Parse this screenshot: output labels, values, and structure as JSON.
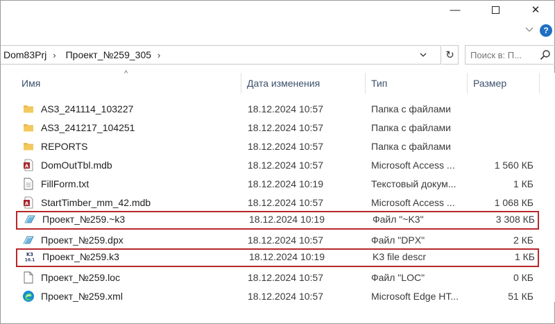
{
  "window": {
    "controls": {
      "minimize": "—",
      "close": "✕"
    }
  },
  "address": {
    "crumbs": [
      "Dom83Prj",
      "Проект_№259_305"
    ],
    "separator": "›",
    "dropdown": "⌄",
    "refresh": "↻"
  },
  "search": {
    "placeholder": "Поиск в: П..."
  },
  "help": {
    "label": "?"
  },
  "columns": {
    "name": "Имя",
    "date": "Дата изменения",
    "type": "Тип",
    "size": "Размер",
    "sort_indicator": "^"
  },
  "files": [
    {
      "icon": "folder-icon",
      "name": "AS3_241114_103227",
      "date": "18.12.2024 10:57",
      "type": "Папка с файлами",
      "size": "",
      "highlighted": false
    },
    {
      "icon": "folder-icon",
      "name": "AS3_241217_104251",
      "date": "18.12.2024 10:57",
      "type": "Папка с файлами",
      "size": "",
      "highlighted": false
    },
    {
      "icon": "folder-icon",
      "name": "REPORTS",
      "date": "18.12.2024 10:57",
      "type": "Папка с файлами",
      "size": "",
      "highlighted": false
    },
    {
      "icon": "access-db-icon",
      "name": "DomOutTbl.mdb",
      "date": "18.12.2024 10:57",
      "type": "Microsoft Access ...",
      "size": "1 560 КБ",
      "highlighted": false
    },
    {
      "icon": "text-file-icon",
      "name": "FillForm.txt",
      "date": "18.12.2024 10:19",
      "type": "Текстовый докум...",
      "size": "1 КБ",
      "highlighted": false
    },
    {
      "icon": "access-db-icon",
      "name": "StartTimber_mm_42.mdb",
      "date": "18.12.2024 10:57",
      "type": "Microsoft Access ...",
      "size": "1 068 КБ",
      "highlighted": false
    },
    {
      "icon": "k3-project-icon",
      "name": "Проект_№259.~k3",
      "date": "18.12.2024 10:19",
      "type": "Файл \"~K3\"",
      "size": "3 308 КБ",
      "highlighted": true
    },
    {
      "icon": "k3-project-icon",
      "name": "Проект_№259.dpx",
      "date": "18.12.2024 10:57",
      "type": "Файл \"DPX\"",
      "size": "2 КБ",
      "highlighted": false
    },
    {
      "icon": "k3-app-icon",
      "name": "Проект_№259.k3",
      "date": "18.12.2024 10:19",
      "type": "K3 file descr",
      "size": "1 КБ",
      "highlighted": true
    },
    {
      "icon": "blank-file-icon",
      "name": "Проект_№259.loc",
      "date": "18.12.2024 10:57",
      "type": "Файл \"LOC\"",
      "size": "0 КБ",
      "highlighted": false
    },
    {
      "icon": "edge-icon",
      "name": "Проект_№259.xml",
      "date": "18.12.2024 10:57",
      "type": "Microsoft Edge HT...",
      "size": "51 КБ",
      "highlighted": false
    }
  ],
  "colors": {
    "highlight_border": "#b8262c",
    "folder": "#e8b64a",
    "header_text": "#3c4f6b",
    "help_badge": "#1f6fc4"
  }
}
